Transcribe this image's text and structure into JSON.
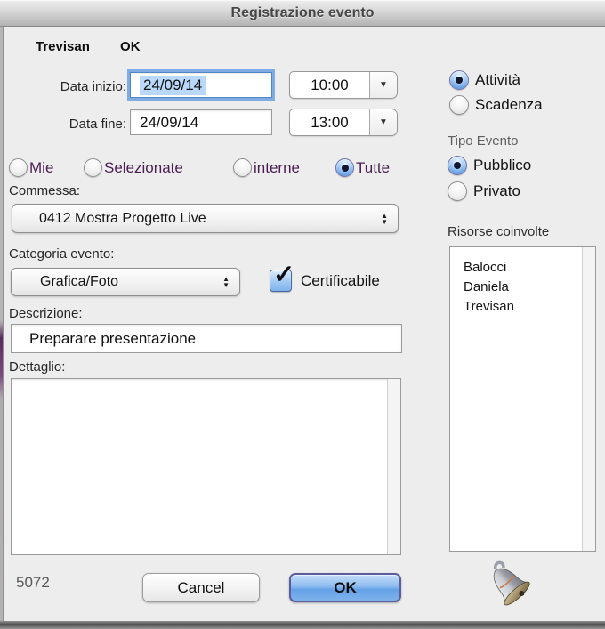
{
  "window": {
    "title": "Registrazione evento"
  },
  "header": {
    "user": "Trevisan",
    "status": "OK"
  },
  "dates": {
    "start_label": "Data inizio:",
    "start_value": "24/09/14",
    "start_time": "10:00",
    "end_label": "Data fine:",
    "end_value": "24/09/14",
    "end_time": "13:00"
  },
  "filters": {
    "options": [
      {
        "label": "Mie",
        "selected": false
      },
      {
        "label": "Selezionate",
        "selected": false
      },
      {
        "label": "interne",
        "selected": false
      },
      {
        "label": "Tutte",
        "selected": true
      }
    ]
  },
  "activity": {
    "options": [
      {
        "label": "Attività",
        "selected": true
      },
      {
        "label": "Scadenza",
        "selected": false
      }
    ]
  },
  "tipo": {
    "label": "Tipo Evento",
    "options": [
      {
        "label": "Pubblico",
        "selected": true
      },
      {
        "label": "Privato",
        "selected": false
      }
    ]
  },
  "commessa": {
    "label": "Commessa:",
    "value": "0412 Mostra Progetto Live"
  },
  "categoria": {
    "label": "Categoria evento:",
    "value": "Grafica/Foto"
  },
  "certificabile": {
    "label": "Certificabile",
    "checked": true
  },
  "descrizione": {
    "label": "Descrizione:",
    "value": "Preparare presentazione"
  },
  "dettaglio": {
    "label": "Dettaglio:",
    "value": ""
  },
  "risorse": {
    "label": "Risorse coinvolte",
    "items": [
      "Balocci",
      "Daniela",
      "Trevisan"
    ]
  },
  "footer": {
    "code": "5072",
    "cancel_label": "Cancel",
    "ok_label": "OK"
  },
  "icons": {
    "combo_arrow": "▼",
    "stepper_up": "▲",
    "stepper_down": "▼",
    "check": "✓"
  },
  "colors": {
    "accent_blue": "#5f9be2",
    "purple_label": "#4b1d52",
    "ok_border": "#5c5c9e",
    "selection_highlight": "#b9d8fb",
    "background": "#ededed"
  }
}
